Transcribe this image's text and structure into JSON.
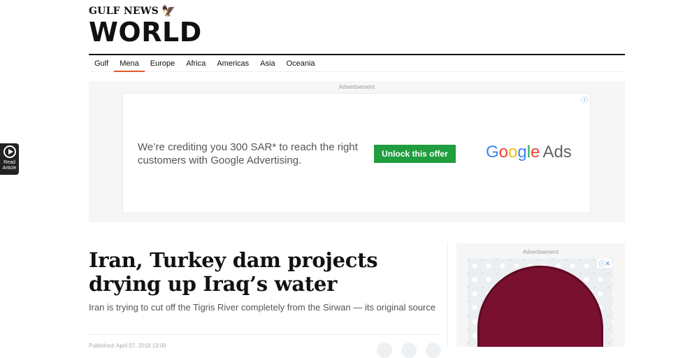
{
  "brand": {
    "small": "GULF NEWS",
    "big": "WORLD"
  },
  "nav": [
    {
      "label": "Gulf"
    },
    {
      "label": "Mena"
    },
    {
      "label": "Europe"
    },
    {
      "label": "Africa"
    },
    {
      "label": "Americas"
    },
    {
      "label": "Asia"
    },
    {
      "label": "Oceania"
    }
  ],
  "active_nav": "Mena",
  "ad_banner": {
    "label": "Advertisement",
    "text": "We’re crediting you 300 SAR* to reach the right customers with Google Advertising.",
    "button": "Unlock this offer",
    "logo_letters": [
      "G",
      "o",
      "o",
      "g",
      "l",
      "e"
    ],
    "logo_suffix": "Ads",
    "info_icon": "info-icon"
  },
  "read_article": {
    "label_line1": "Read",
    "label_line2": "Article"
  },
  "article": {
    "headline": "Iran, Turkey dam projects drying up Iraq’s water",
    "subtitle": "Iran is trying to cut off the Tigris River completely from the Sirwan — its original source",
    "published": "Published: April 07, 2018 13:00"
  },
  "side_ad": {
    "label": "Advertisement",
    "badge": "ⓘ✕"
  },
  "colors": {
    "accent": "#e05a2b",
    "ad_button": "#1f9d3f",
    "ad_image": "#7a1030"
  }
}
